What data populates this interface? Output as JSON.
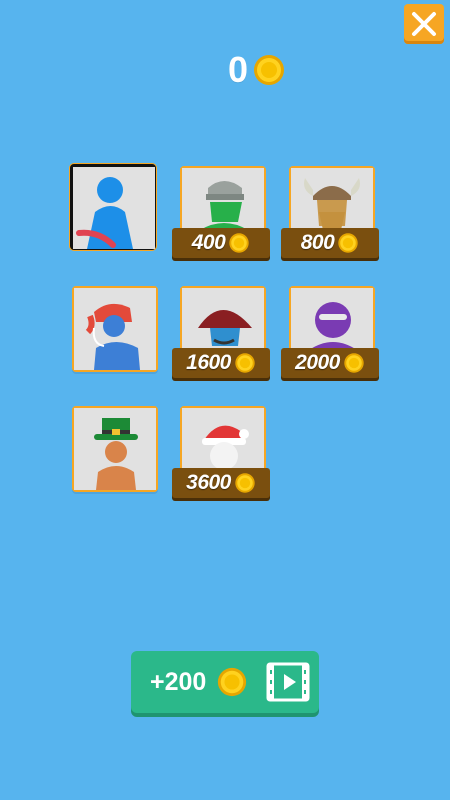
{
  "coins": {
    "value": "0"
  },
  "skins": [
    {
      "name": "blue",
      "selected": true
    },
    {
      "name": "knight",
      "price": "400"
    },
    {
      "name": "viking",
      "price": "800"
    },
    {
      "name": "redhead",
      "price": ""
    },
    {
      "name": "pirate",
      "price": "1600"
    },
    {
      "name": "ninja",
      "price": "2000"
    },
    {
      "name": "leprechaun",
      "price": ""
    },
    {
      "name": "santa",
      "price": "3600"
    }
  ],
  "reward_button": {
    "label": "+200"
  },
  "colors": {
    "background": "#57b4ee",
    "accent": "#f6a623",
    "price_tag": "#7a4f0f",
    "reward_button": "#2bb88a"
  }
}
